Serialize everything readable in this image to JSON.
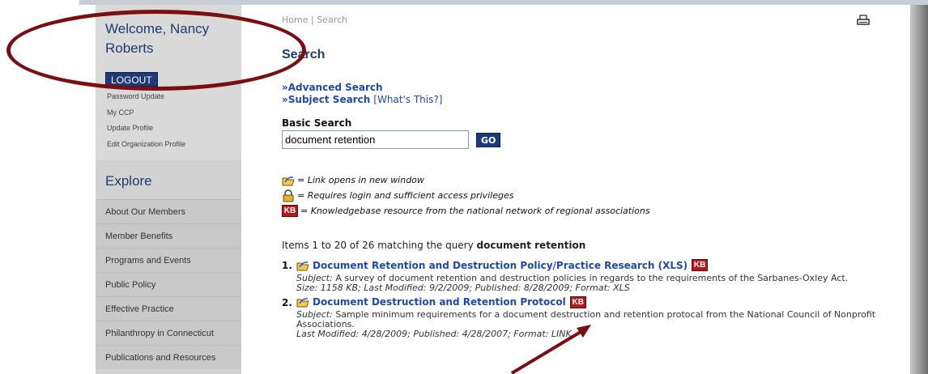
{
  "user": {
    "welcome": "Welcome, Nancy Roberts",
    "logout_label": "LOGOUT"
  },
  "account_links": [
    "Password Update",
    "My CCP",
    "Update Profile",
    "Edit Organization Profile"
  ],
  "explore": {
    "title": "Explore",
    "items": [
      "About Our Members",
      "Member Benefits",
      "Programs and Events",
      "Public Policy",
      "Effective Practice",
      "Philanthropy in Connecticut",
      "Publications and Resources"
    ]
  },
  "breadcrumb": {
    "home": "Home",
    "separator": "|",
    "current": "Search"
  },
  "page": {
    "title": "Search"
  },
  "search_links": {
    "advanced": "»Advanced Search",
    "subject": "»Subject Search",
    "whats_this": "[What's This?]"
  },
  "basic_search": {
    "label": "Basic Search",
    "value": "document retention",
    "go_label": "GO"
  },
  "legend": {
    "new_window": "= Link opens in new window",
    "login": "= Requires login and sufficient access privileges",
    "kb": "= Knowledgebase resource from the national network of regional associations",
    "kb_badge": "KB"
  },
  "results_summary": {
    "prefix": "Items 1 to 20 of 26 matching the query",
    "query": "document retention"
  },
  "results": [
    {
      "num": "1.",
      "title": "Document Retention and Destruction Policy/Practice Research (XLS)",
      "subject_label": "Subject:",
      "subject": "A survey of document retention and destruction policies in regards to the requirements of the Sarbanes-Oxley Act.",
      "details": "Size: 1158 KB; Last Modified: 9/2/2009; Published: 8/28/2009; Format: XLS"
    },
    {
      "num": "2.",
      "title": "Document Destruction and Retention Protocol",
      "subject_label": "Subject:",
      "subject": "Sample minimum requirements for a document destruction and retention protocal from the National Council of Nonprofit Associations.",
      "details": "Last Modified: 4/28/2009; Published: 4/28/2007; Format: LINK"
    }
  ],
  "colors": {
    "accent_navy": "#1e3a78",
    "link_blue": "#1f4aa8",
    "annotation_red": "#7b0e10",
    "kb_red": "#b41a1a"
  }
}
